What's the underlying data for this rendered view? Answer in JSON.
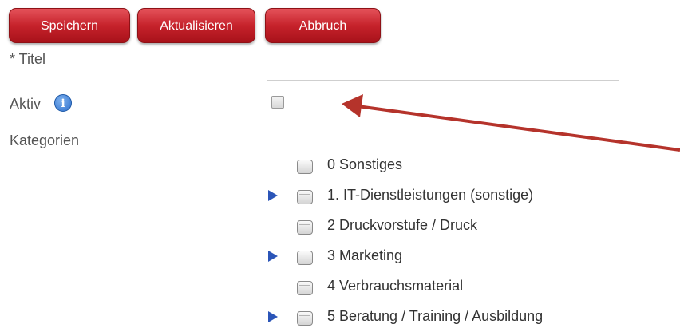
{
  "toolbar": {
    "save_label": "Speichern",
    "update_label": "Aktualisieren",
    "cancel_label": "Abbruch"
  },
  "form": {
    "title_label": "* Titel",
    "title_value": "",
    "active_label": "Aktiv",
    "active_checked": false,
    "info_icon_glyph": "i",
    "categories_label": "Kategorien"
  },
  "categories": [
    {
      "label": "0 Sonstiges",
      "expandable": false
    },
    {
      "label": "1. IT-Dienstleistungen (sonstige)",
      "expandable": true
    },
    {
      "label": "2 Druckvorstufe / Druck",
      "expandable": false
    },
    {
      "label": "3 Marketing",
      "expandable": true
    },
    {
      "label": "4 Verbrauchsmaterial",
      "expandable": false
    },
    {
      "label": "5 Beratung / Training / Ausbildung",
      "expandable": true
    }
  ],
  "colors": {
    "button": "#c6222b",
    "annotation_arrow": "#b5332b",
    "expander": "#2b55b8"
  },
  "icons": {
    "info": "info-icon",
    "expander": "triangle-right-icon",
    "annotation": "arrow-icon"
  }
}
